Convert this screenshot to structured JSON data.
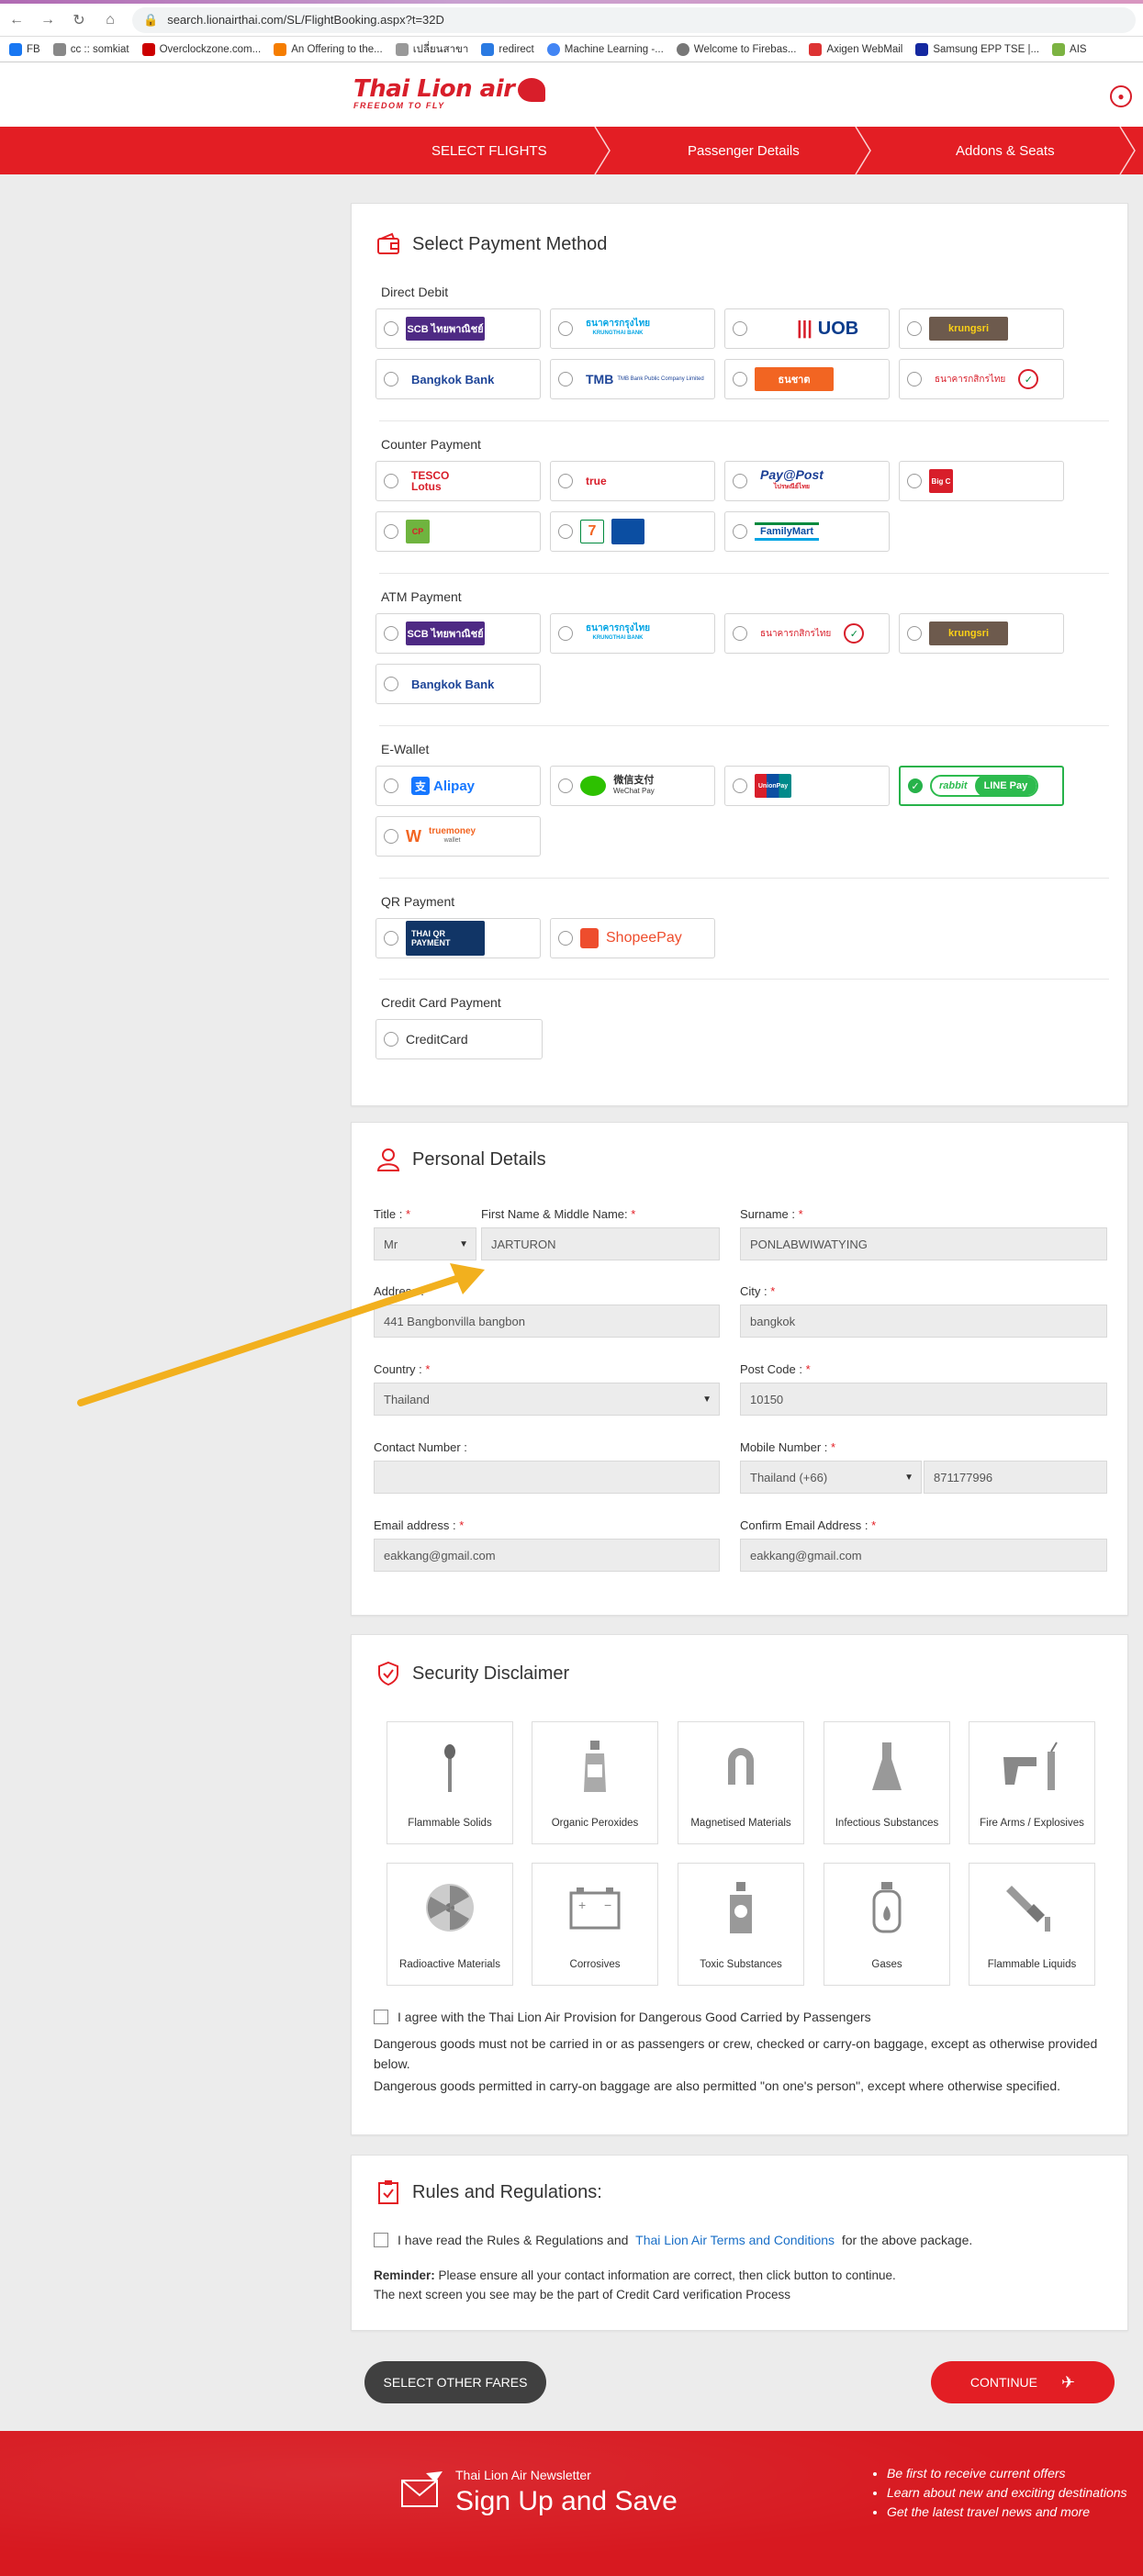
{
  "browser": {
    "url": "search.lionairthai.com/SL/FlightBooking.aspx?t=32D",
    "bookmarks": [
      "FB",
      "cc :: somkiat",
      "Overclockzone.com...",
      "An Offering to the...",
      "เปลี่ยนสาขา",
      "redirect",
      "Machine Learning -...",
      "Welcome to Firebas...",
      "Axigen WebMail",
      "Samsung EPP TSE |...",
      "AIS"
    ]
  },
  "header": {
    "logo_text": "Thai Lion air",
    "logo_tagline": "FREEDOM TO FLY"
  },
  "steps": [
    "SELECT FLIGHTS",
    "Passenger Details",
    "Addons & Seats"
  ],
  "payment": {
    "title": "Select Payment Method",
    "groups": {
      "direct_debit": "Direct Debit",
      "counter": "Counter Payment",
      "atm": "ATM Payment",
      "ewallet": "E-Wallet",
      "qr": "QR Payment",
      "credit": "Credit Card Payment"
    },
    "brands": {
      "scb": "SCB ไทยพาณิชย์",
      "ktb": "ธนาคารกรุงไทย",
      "ktb_sub": "KRUNGTHAI BANK",
      "uob": "UOB",
      "krungsri": "krungsri",
      "bbl": "Bangkok Bank",
      "tmb": "TMB",
      "tmb_sub": "TMB Bank Public Company Limited",
      "thanachart": "ธนชาต",
      "kbank": "ธนาคารกสิกรไทย",
      "tesco": "TESCO Lotus",
      "true": "true",
      "paypost": "Pay@Post",
      "paypost_sub": "ไปรษณีย์ไทย",
      "bigc": "Big C",
      "cp": "CP",
      "seven": "7",
      "familymart": "FamilyMart",
      "alipay": "Alipay",
      "wechat": "微信支付",
      "wechat_sub": "WeChat Pay",
      "unionpay": "UnionPay",
      "rabbit": "rabbit",
      "linepay": "LINE Pay",
      "truemoney": "truemoney",
      "truemoney_sub": "wallet",
      "thaiqr": "THAI QR PAYMENT",
      "shopeepay": "ShopeePay",
      "creditcard": "CreditCard"
    }
  },
  "personal": {
    "title": "Personal Details",
    "labels": {
      "title": "Title :",
      "first": "First Name & Middle Name:",
      "surname": "Surname :",
      "address": "Address :",
      "city": "City :",
      "country": "Country :",
      "postcode": "Post Code :",
      "contact": "Contact Number :",
      "mobile": "Mobile Number :",
      "email": "Email address :",
      "confirm_email": "Confirm Email Address :"
    },
    "required_mark": "*",
    "values": {
      "title": "Mr",
      "first": "JARTURON",
      "surname": "PONLABWIWATYING",
      "address": "441 Bangbonvilla bangbon",
      "city": "bangkok",
      "country": "Thailand",
      "postcode": "10150",
      "contact": "",
      "mobile_country": "Thailand (+66)",
      "mobile": "871177996",
      "email": "eakkang@gmail.com",
      "confirm_email": "eakkang@gmail.com"
    }
  },
  "security": {
    "title": "Security Disclaimer",
    "items": [
      "Flammable Solids",
      "Organic Peroxides",
      "Magnetised Materials",
      "Infectious Substances",
      "Fire Arms / Explosives",
      "Radioactive Materials",
      "Corrosives",
      "Toxic Substances",
      "Gases",
      "Flammable Liquids"
    ],
    "agree": "I agree with the Thai Lion Air Provision for Dangerous Good Carried by Passengers",
    "text1": "Dangerous goods must not be carried in or as passengers or crew, checked or carry-on baggage, except as otherwise provided below.",
    "text2": "Dangerous goods permitted in carry-on baggage are also permitted \"on one's person\", except where otherwise specified."
  },
  "rules": {
    "title": "Rules and Regulations:",
    "read_prefix": "I have read the Rules & Regulations and",
    "link": "Thai Lion Air Terms and Conditions",
    "read_suffix": "for the above package.",
    "reminder_label": "Reminder:",
    "reminder": "Please ensure all your contact information are correct, then click button to continue.",
    "next_screen": "The next screen you see may be the part of Credit Card verification Process"
  },
  "buttons": {
    "other_fares": "SELECT OTHER FARES",
    "continue": "CONTINUE"
  },
  "footer": {
    "newsletter": "Thai Lion Air Newsletter",
    "signup": "Sign Up and Save",
    "bullets": [
      "Be first to receive current offers",
      "Learn about new and exciting destinations",
      "Get the latest travel news and more"
    ]
  },
  "colors": {
    "brand_red": "#e31e24",
    "selected_green": "#27b24a",
    "annotation_arrow": "#f2b01e"
  }
}
